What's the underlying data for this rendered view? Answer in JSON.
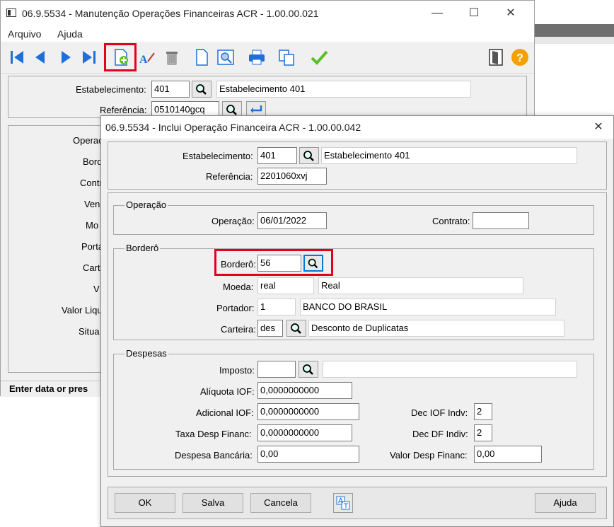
{
  "main_window": {
    "title": "06.9.5534 - Manutenção Operações Financeiras ACR - 1.00.00.021",
    "controls": {
      "minimize": "—",
      "maximize": "☐",
      "close": "✕"
    },
    "menu": [
      "Arquivo",
      "Ajuda"
    ],
    "toolbar_icons": [
      "first-icon",
      "prev-icon",
      "next-icon",
      "last-icon",
      "add-icon",
      "edit-icon",
      "delete-icon",
      "document-icon",
      "search-doc-icon",
      "print-icon",
      "copy-icon",
      "check-icon",
      "exit-door-icon",
      "help-icon"
    ],
    "help_glyph": "?",
    "estabelecimento_label": "Estabelecimento:",
    "estabelecimento_code": "401",
    "estabelecimento_name": "Estabelecimento 401",
    "referencia_label": "Referência:",
    "referencia_value": "0510140gcq",
    "truncated_labels": [
      "Operaç",
      "Bord",
      "Contr",
      "Ven",
      "Mo",
      "Porta",
      "Cart",
      "V",
      "Valor Liqu",
      "Situa"
    ],
    "status_text": "Enter data or pres"
  },
  "dialog": {
    "title": "06.9.5534 - Inclui Operação Financeira ACR - 1.00.00.042",
    "close_glyph": "✕",
    "estabelecimento_label": "Estabelecimento:",
    "estabelecimento_code": "401",
    "estabelecimento_name": "Estabelecimento 401",
    "referencia_label": "Referência:",
    "referencia_value": "2201060xvj",
    "operacao_group": "Operação",
    "operacao_label": "Operação:",
    "operacao_value": "06/01/2022",
    "contrato_label": "Contrato:",
    "contrato_value": "",
    "bordero_group": "Borderô",
    "bordero_label": "Borderô:",
    "bordero_value": "56",
    "moeda_label": "Moeda:",
    "moeda_code": "real",
    "moeda_name": "Real",
    "portador_label": "Portador:",
    "portador_code": "1",
    "portador_name": "BANCO DO BRASIL",
    "carteira_label": "Carteira:",
    "carteira_code": "des",
    "carteira_name": "Desconto de Duplicatas",
    "despesas_group": "Despesas",
    "imposto_label": "Imposto:",
    "imposto_code": "",
    "imposto_name": "",
    "aliquota_label": "Alíquota IOF:",
    "aliquota_value": "0,0000000000",
    "adicional_label": "Adicional IOF:",
    "adicional_value": "0,0000000000",
    "taxa_label": "Taxa Desp Financ:",
    "taxa_value": "0,0000000000",
    "despesa_label": "Despesa Bancária:",
    "despesa_value": "0,00",
    "dec_iof_label": "Dec IOF Indv:",
    "dec_iof_value": "2",
    "dec_df_label": "Dec DF Indiv:",
    "dec_df_value": "2",
    "valor_desp_label": "Valor Desp Financ:",
    "valor_desp_value": "0,00",
    "buttons": {
      "ok": "OK",
      "salva": "Salva",
      "cancela": "Cancela",
      "ajuda": "Ajuda"
    }
  },
  "colors": {
    "highlight": "#e3001b",
    "nav_blue": "#1e6fd9",
    "check_green": "#5bbf2a",
    "help_orange": "#f4a100"
  }
}
